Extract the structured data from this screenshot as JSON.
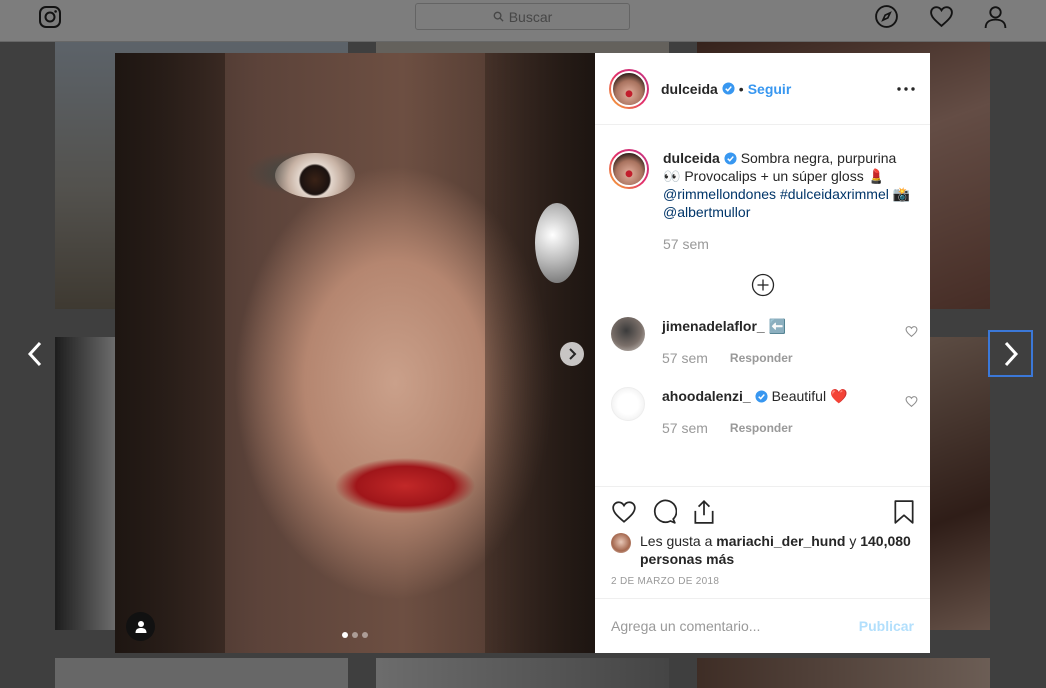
{
  "topbar": {
    "search_placeholder": "Buscar",
    "icons": [
      "instagram-logo-icon",
      "search-icon",
      "compass-icon",
      "heart-icon",
      "profile-icon"
    ]
  },
  "post": {
    "author": "dulceida",
    "follow_label": "Seguir",
    "separator": "•",
    "caption": {
      "username": "dulceida",
      "text": "Sombra negra, purpurina 👀 Provocalips + un súper gloss 💄",
      "mention_1": "@rimmellondones",
      "hashtag": "#dulceidaxrimmel",
      "camera_emoji": "📸",
      "mention_2": "@albertmullor",
      "time": "57 sem"
    },
    "comments": [
      {
        "username": "jimenadelaflor_",
        "text": "⬅️",
        "time": "57 sem",
        "reply_label": "Responder"
      },
      {
        "username": "ahoodalenzi_",
        "text": "Beautiful ❤️",
        "time": "57 sem",
        "reply_label": "Responder"
      }
    ],
    "likes": {
      "prefix": "Les gusta a",
      "user": "mariachi_der_hund",
      "conjunction": "y",
      "others": "140,080 personas más"
    },
    "date": "2 DE MARZO DE 2018",
    "comment_placeholder": "Agrega un comentario...",
    "publish_label": "Publicar",
    "carousel": {
      "index": 1,
      "total": 3
    }
  },
  "colors": {
    "accent": "#3897f0",
    "publish_disabled": "#b2dffc",
    "focus_border": "#3b78d8",
    "muted_text": "#999999"
  }
}
